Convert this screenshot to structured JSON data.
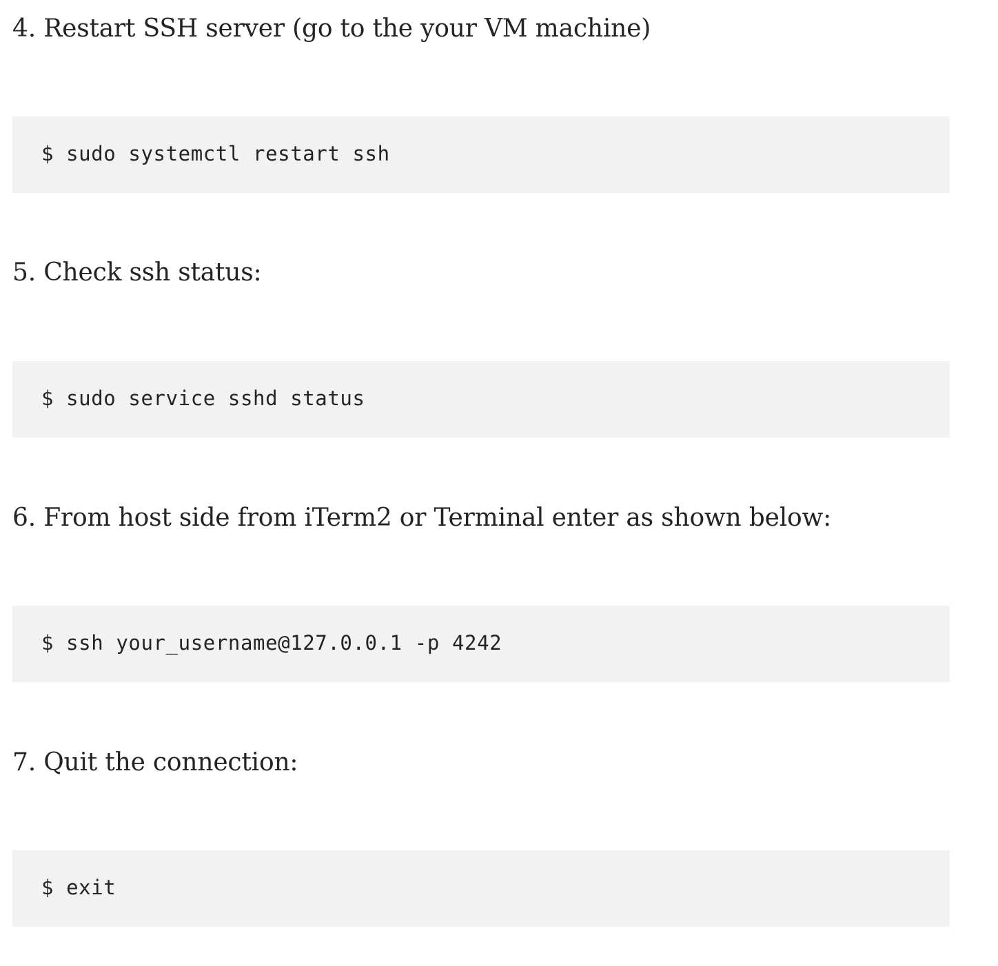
{
  "steps": [
    {
      "heading": "4. Restart SSH server (go to the your VM machine)",
      "command": "$ sudo systemctl restart ssh"
    },
    {
      "heading": "5. Check ssh status:",
      "command": "$ sudo service sshd status"
    },
    {
      "heading": "6. From host side from iTerm2 or Terminal enter as shown below:",
      "command": "$ ssh your_username@127.0.0.1 -p 4242"
    },
    {
      "heading": "7. Quit the connection:",
      "command": "$ exit"
    }
  ],
  "colors": {
    "text": "#242424",
    "code_background": "#f2f2f2",
    "page_background": "#ffffff"
  }
}
